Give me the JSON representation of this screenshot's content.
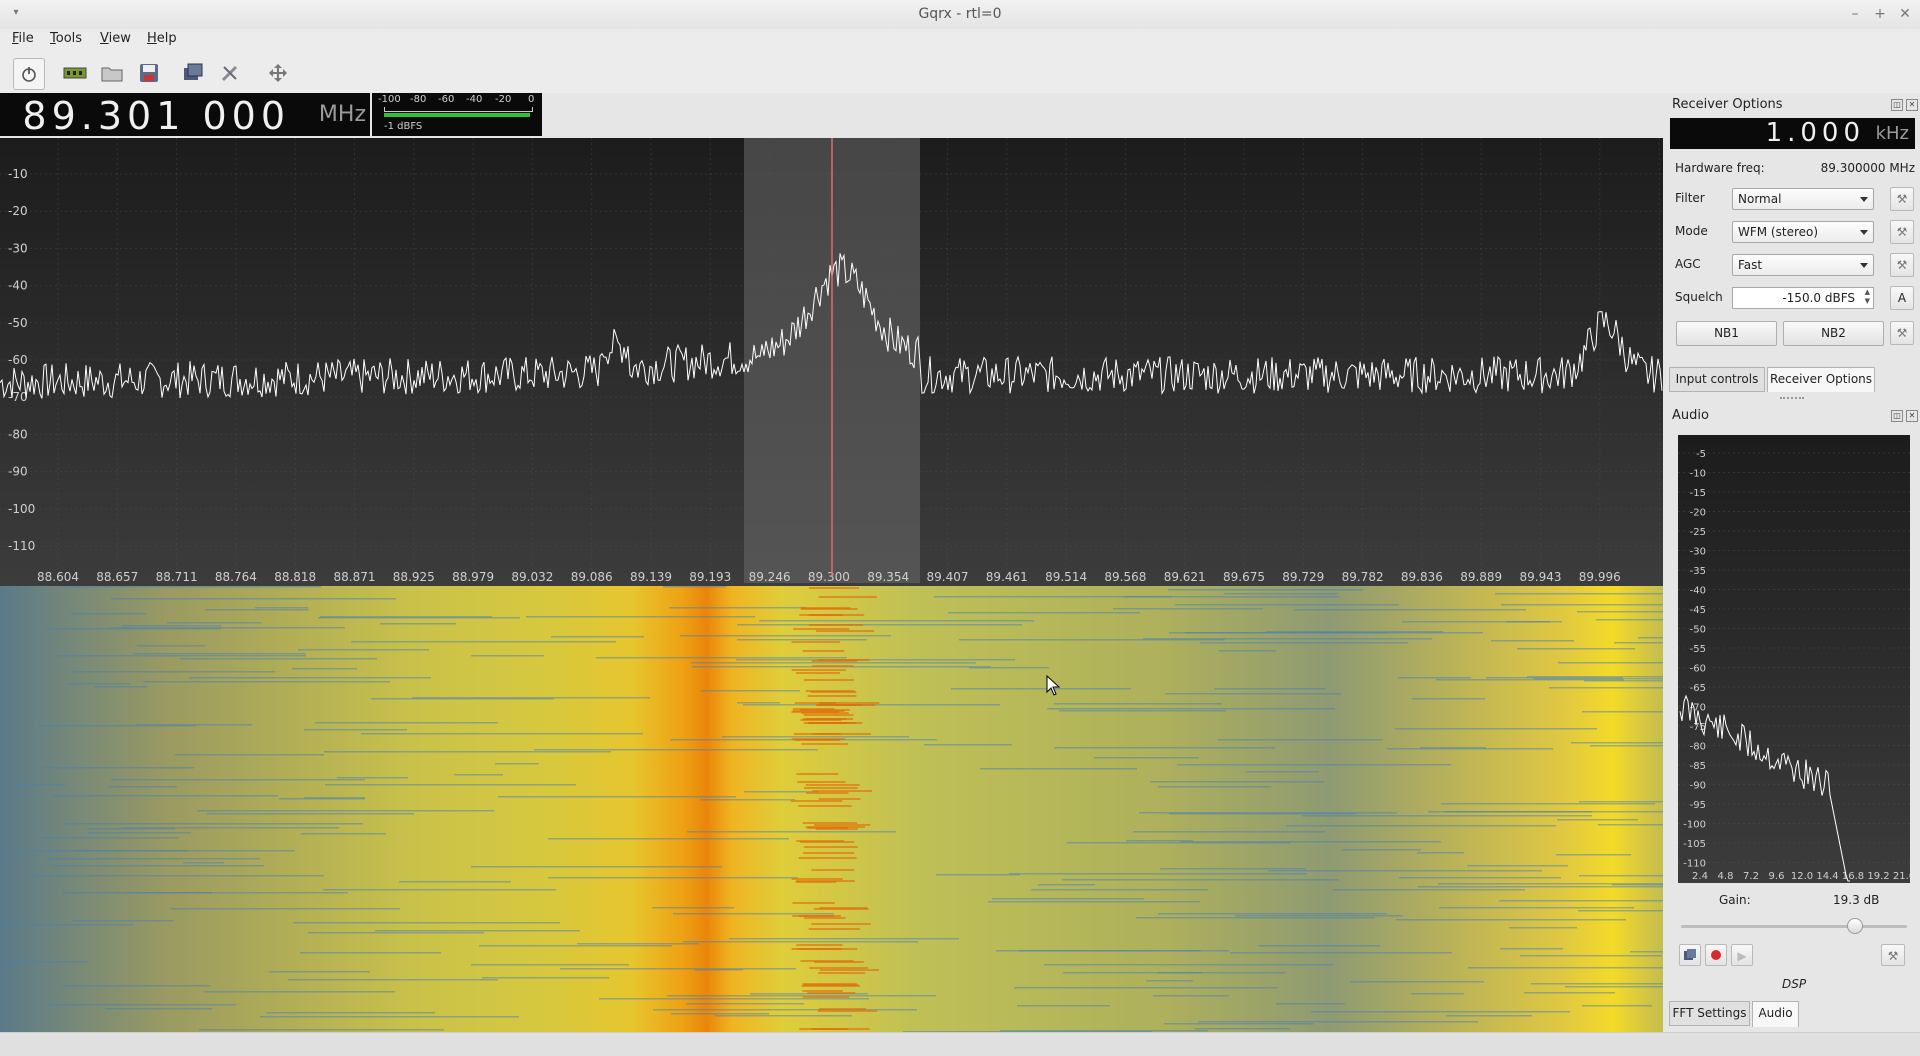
{
  "window": {
    "title": "Gqrx - rtl=0",
    "menu": [
      "File",
      "Tools",
      "View",
      "Help"
    ]
  },
  "toolbar": {
    "icons": [
      "power-icon",
      "rtl-device-icon",
      "open-folder-icon",
      "save-icon",
      "screenshot-icon",
      "tools-icon",
      "fullscreen-icon"
    ]
  },
  "frequency": {
    "value": "89.301 000",
    "unit": "MHz"
  },
  "signal_meter": {
    "scale": [
      "-100",
      "-80",
      "-60",
      "-40",
      "-20",
      "0"
    ],
    "readout": "-1 dBFS",
    "level": 0.99
  },
  "spectrum": {
    "y_labels": [
      "-10",
      "-20",
      "-30",
      "-40",
      "-50",
      "-60",
      "-70",
      "-80",
      "-90",
      "-100",
      "-110"
    ],
    "x_labels": [
      "88.604",
      "88.657",
      "88.711",
      "88.764",
      "88.818",
      "88.871",
      "88.925",
      "88.979",
      "89.032",
      "89.086",
      "89.139",
      "89.193",
      "89.246",
      "89.300",
      "89.354",
      "89.407",
      "89.461",
      "89.514",
      "89.568",
      "89.621",
      "89.675",
      "89.729",
      "89.782",
      "89.836",
      "89.889",
      "89.943",
      "89.996"
    ],
    "colors": {
      "trace": "#ffffff",
      "marker": "#e06b6b",
      "filter": "#6a6a6a"
    }
  },
  "receiver_options": {
    "title": "Receiver Options",
    "offset_value": "1.000",
    "offset_unit": "kHz",
    "hw_label": "Hardware freq:",
    "hw_value": "89.300000 MHz",
    "filter_label": "Filter",
    "filter_value": "Normal",
    "mode_label": "Mode",
    "mode_value": "WFM (stereo)",
    "agc_label": "AGC",
    "agc_value": "Fast",
    "squelch_label": "Squelch",
    "squelch_value": "-150.0 dBFS",
    "squelch_auto": "A",
    "nb1": "NB1",
    "nb2": "NB2",
    "tabs": [
      "Input controls",
      "Receiver Options"
    ]
  },
  "audio": {
    "title": "Audio",
    "y_labels": [
      "-5",
      "-10",
      "-15",
      "-20",
      "-25",
      "-30",
      "-35",
      "-40",
      "-45",
      "-50",
      "-55",
      "-60",
      "-65",
      "-70",
      "-75",
      "-80",
      "-85",
      "-90",
      "-95",
      "-100",
      "-105",
      "-110"
    ],
    "x_labels": [
      "2.4",
      "4.8",
      "7.2",
      "9.6",
      "12.0",
      "14.4",
      "16.8",
      "19.2",
      "21.6"
    ],
    "gain_label": "Gain:",
    "gain_value": "19.3 dB",
    "gain_level": 0.77,
    "dsp_label": "DSP",
    "tabs": [
      "FFT Settings",
      "Audio"
    ]
  }
}
